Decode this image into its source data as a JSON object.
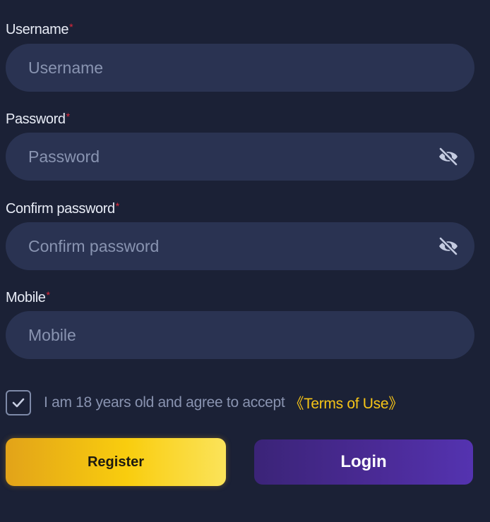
{
  "form": {
    "username": {
      "label": "Username",
      "required_mark": "*",
      "placeholder": "Username",
      "value": ""
    },
    "password": {
      "label": "Password",
      "required_mark": "*",
      "placeholder": "Password",
      "value": "",
      "toggle_icon": "eye-slash-icon"
    },
    "confirm_password": {
      "label": "Confirm password",
      "required_mark": "*",
      "placeholder": "Confirm password",
      "value": "",
      "toggle_icon": "eye-slash-icon"
    },
    "mobile": {
      "label": "Mobile",
      "required_mark": "*",
      "placeholder": "Mobile",
      "value": ""
    },
    "agreement": {
      "checked": true,
      "text": "I am 18 years old and agree to accept",
      "terms_link": "《Terms of Use》"
    }
  },
  "buttons": {
    "register_label": "Register",
    "login_label": "Login"
  },
  "colors": {
    "background": "#1b2136",
    "input_bg": "#2a3352",
    "required": "#e0283a",
    "terms_link": "#f6c417",
    "register_gradient": [
      "#e2a319",
      "#fbe35a"
    ],
    "login_gradient": [
      "#3b2478",
      "#5433b0"
    ]
  }
}
